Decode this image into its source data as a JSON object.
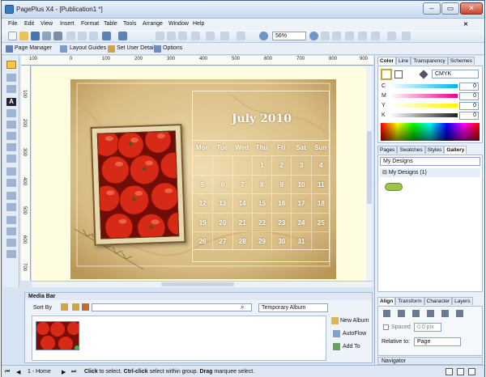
{
  "window": {
    "title": "PagePlus X4 - [Publication1 *]",
    "controls": [
      "–",
      "▭",
      "✕"
    ]
  },
  "menu": [
    "File",
    "Edit",
    "View",
    "Insert",
    "Format",
    "Table",
    "Tools",
    "Arrange",
    "Window",
    "Help"
  ],
  "toolbar": {
    "zoom": "56%"
  },
  "context_bar": {
    "page_manager": "Page Manager",
    "layout_guides": "Layout Guides",
    "set_user_details": "Set User Details",
    "options": "Options"
  },
  "rulers": {
    "h_ticks": [
      "100",
      "0",
      "100",
      "200",
      "300",
      "400",
      "500",
      "600",
      "700",
      "800",
      "900"
    ],
    "v_ticks": [
      "100",
      "200",
      "300",
      "400",
      "500",
      "600",
      "700"
    ]
  },
  "calendar": {
    "title": "July 2010",
    "weekdays": [
      "Mon",
      "Tue",
      "Wed",
      "Thu",
      "Fri",
      "Sat",
      "Sun"
    ],
    "weeks": [
      [
        "",
        "",
        "",
        "1",
        "2",
        "3",
        "4"
      ],
      [
        "5",
        "6",
        "7",
        "8",
        "9",
        "10",
        "11"
      ],
      [
        "12",
        "13",
        "14",
        "15",
        "16",
        "17",
        "18"
      ],
      [
        "19",
        "20",
        "21",
        "22",
        "23",
        "24",
        "25"
      ],
      [
        "26",
        "27",
        "28",
        "29",
        "30",
        "31",
        ""
      ]
    ]
  },
  "color_panel": {
    "tabs": [
      "Color",
      "Line",
      "Transparency",
      "Schemes"
    ],
    "mode": "CMYK",
    "channels": [
      {
        "label": "C",
        "value": "0",
        "color": "#00b7eb"
      },
      {
        "label": "M",
        "value": "0",
        "color": "#ec008c"
      },
      {
        "label": "Y",
        "value": "0",
        "color": "#fff200"
      },
      {
        "label": "K",
        "value": "0",
        "color": "#222222"
      }
    ]
  },
  "gallery_panel": {
    "tabs": [
      "Pages",
      "Swatches",
      "Styles",
      "Gallery"
    ],
    "dropdown": "My Designs",
    "tree_item": "My Designs (1)"
  },
  "align_panel": {
    "tabs": [
      "Align",
      "Transform",
      "Character",
      "Layers"
    ],
    "spaced_label": "Spaced",
    "spaced_value": "0.0 pix",
    "relative_label": "Relative to:",
    "relative_value": "Page"
  },
  "navigator": {
    "label": "Navigator"
  },
  "media_bar": {
    "title": "Media Bar",
    "sort_by": "Sort By",
    "album": "Temporary Album",
    "new_album": "New Album",
    "autoflow": "AutoFlow",
    "add_to": "Add To"
  },
  "status": {
    "page": "1 - Home",
    "hint_1": "Click",
    "hint_2": "to select.",
    "hint_3": "Ctrl-click",
    "hint_4": "select within group.",
    "hint_5": "Drag",
    "hint_6": "marquee select."
  }
}
